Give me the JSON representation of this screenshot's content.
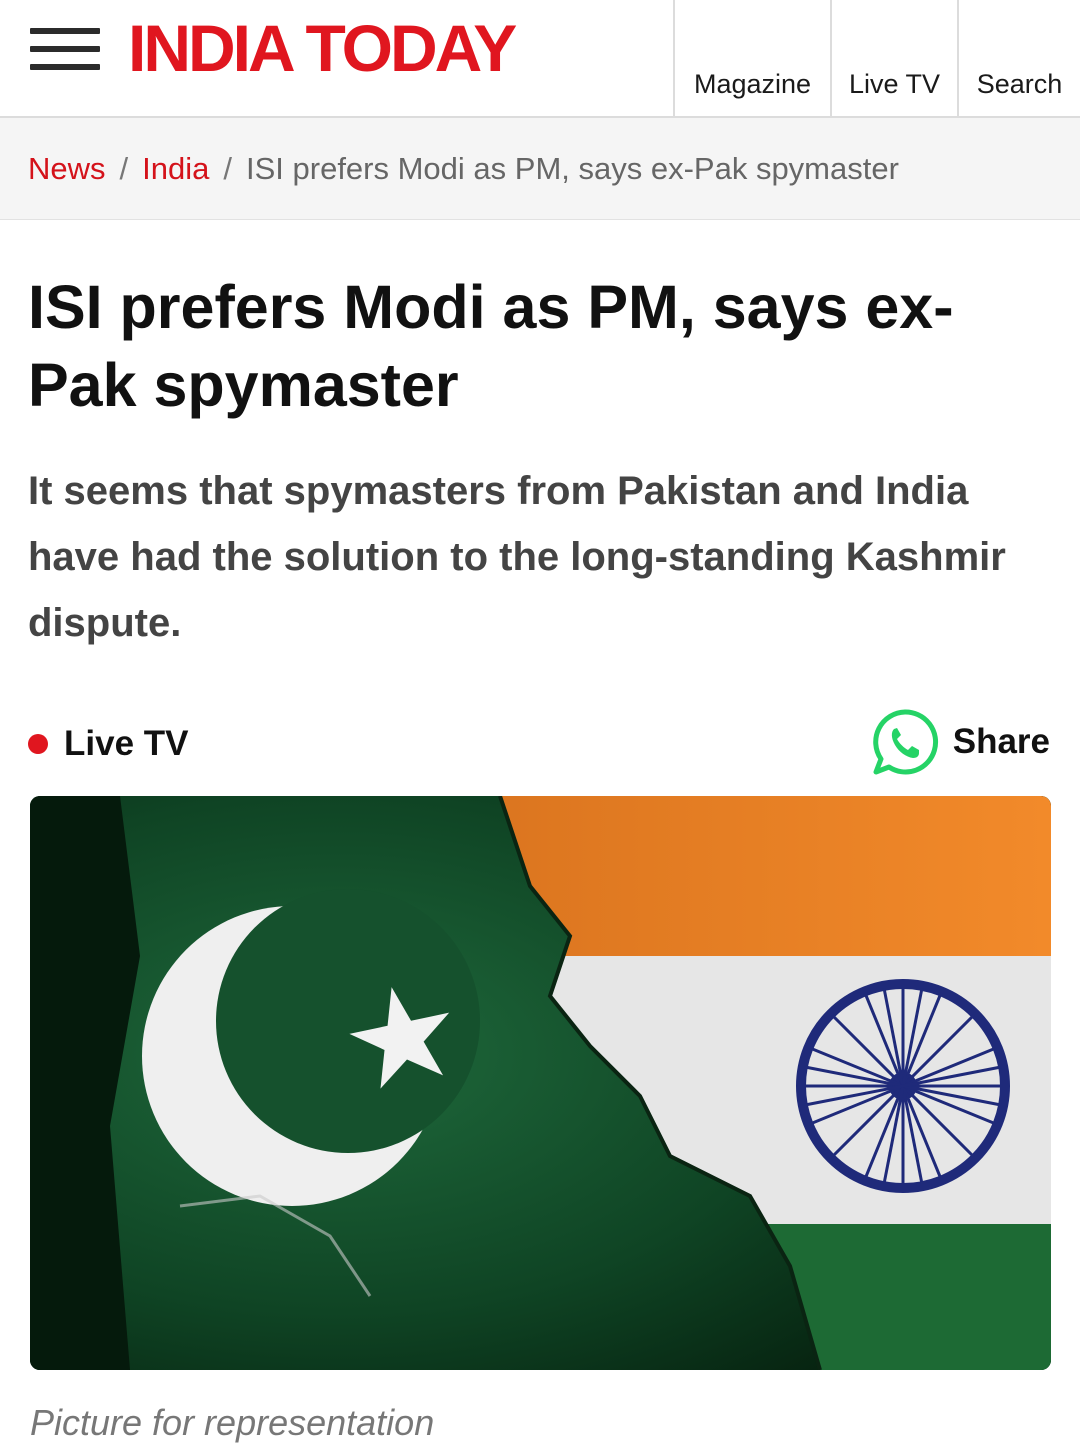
{
  "header": {
    "logo": "INDIA TODAY",
    "nav": {
      "magazine": "Magazine",
      "live_tv": "Live TV",
      "search": "Search"
    }
  },
  "breadcrumb": {
    "items": [
      "News",
      "India"
    ],
    "separator": "/",
    "current": "ISI prefers Modi as PM, says ex-Pak spymaster"
  },
  "article": {
    "title": "ISI prefers Modi as PM, says ex-Pak spymaster",
    "summary": "It seems that spymasters from Pakistan and India have had the solution to the long-standing Kashmir dispute.",
    "live_tv": "Live TV",
    "share": "Share",
    "image_caption": "Picture for representation"
  },
  "colors": {
    "brand": "#e0161f",
    "whatsapp": "#25d366"
  },
  "icons": {
    "menu": "hamburger-menu-icon",
    "live": "live-dot-icon",
    "share": "whatsapp-icon"
  }
}
